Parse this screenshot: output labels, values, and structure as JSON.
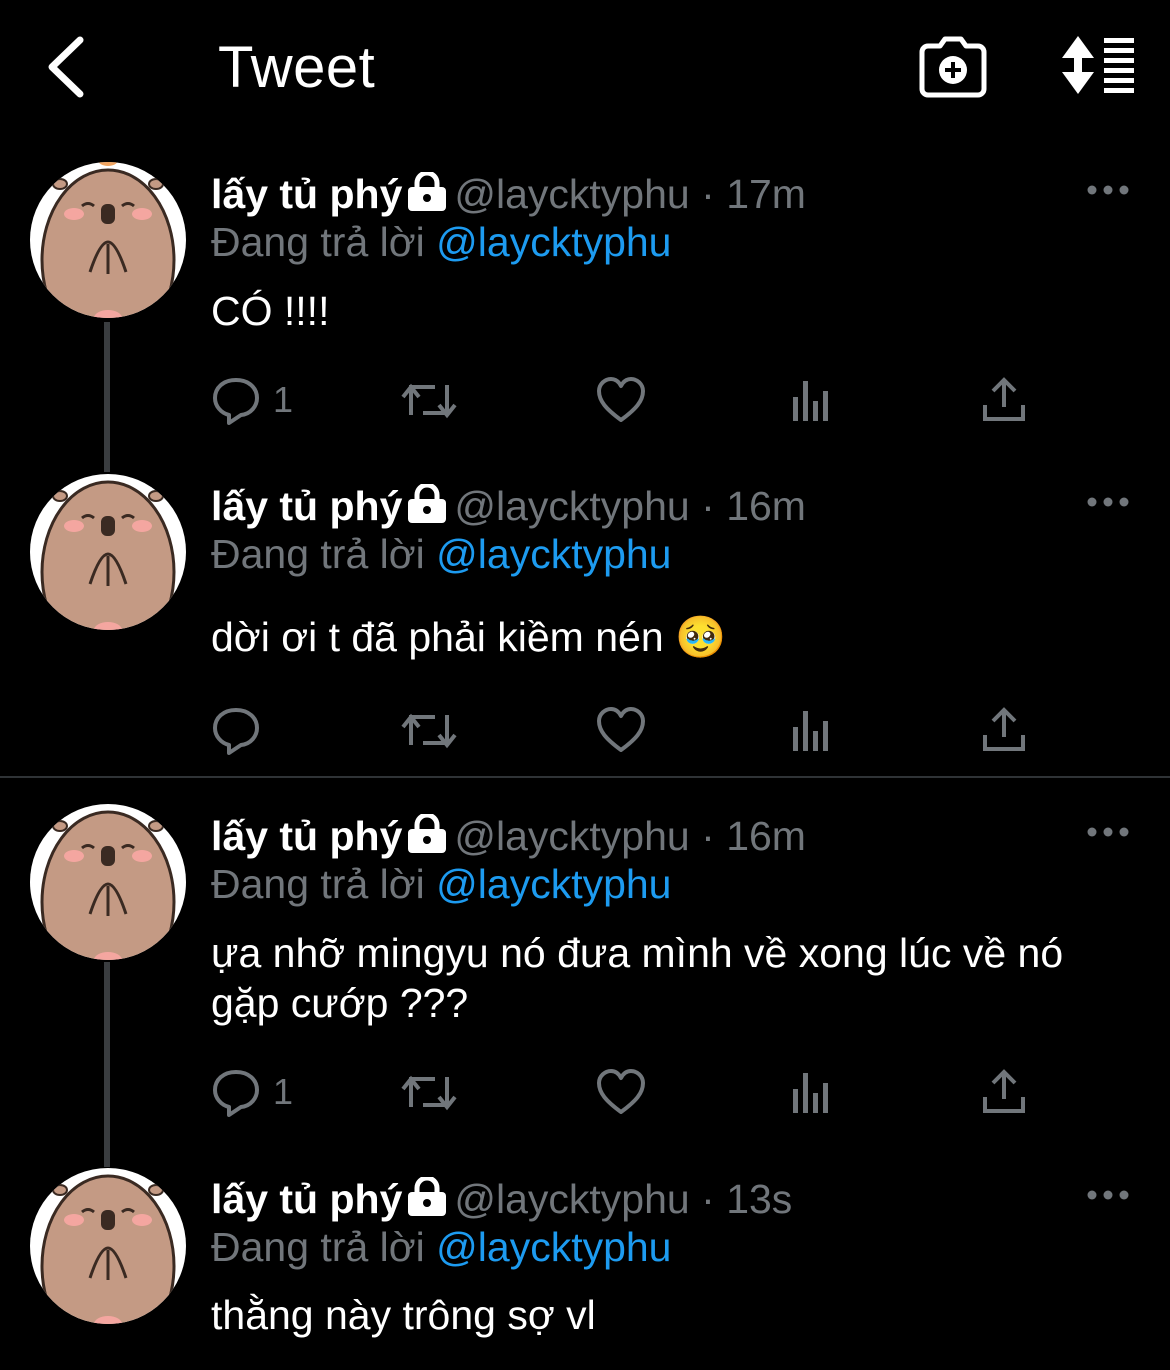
{
  "header": {
    "title": "Tweet"
  },
  "tweets": [
    {
      "name": "lấy tủ phý",
      "handle": "@laycktyphu",
      "sep": "·",
      "time": "17m",
      "replying_prefix": "Đang trả lời",
      "replying_to": "@laycktyphu",
      "text": "CÓ !!!!",
      "reply_count": "1"
    },
    {
      "name": "lấy tủ phý",
      "handle": "@laycktyphu",
      "sep": "·",
      "time": "16m",
      "replying_prefix": "Đang trả lời",
      "replying_to": "@laycktyphu",
      "text": "dời ơi t đã phải kiềm nén 🥹",
      "reply_count": ""
    },
    {
      "name": "lấy tủ phý",
      "handle": "@laycktyphu",
      "sep": "·",
      "time": "16m",
      "replying_prefix": "Đang trả lời",
      "replying_to": "@laycktyphu",
      "text": "ựa nhỡ mingyu nó đưa mình về xong lúc về nó gặp cướp ???",
      "reply_count": "1"
    },
    {
      "name": "lấy tủ phý",
      "handle": "@laycktyphu",
      "sep": "·",
      "time": "13s",
      "replying_prefix": "Đang trả lời",
      "replying_to": "@laycktyphu",
      "text": "thằng này trông sợ vl"
    }
  ],
  "icons": {
    "back": "chevron-left-icon",
    "camera": "camera-plus-icon",
    "sort": "sort-icon",
    "reply": "reply-icon",
    "retweet": "retweet-icon",
    "like": "heart-icon",
    "views": "views-icon",
    "share": "share-icon",
    "more": "more-icon",
    "lock": "lock-icon"
  },
  "colors": {
    "background": "#000000",
    "text": "#ffffff",
    "secondary": "#71767b",
    "mention": "#1d9bf0",
    "avatar_body": "#c49a84"
  }
}
